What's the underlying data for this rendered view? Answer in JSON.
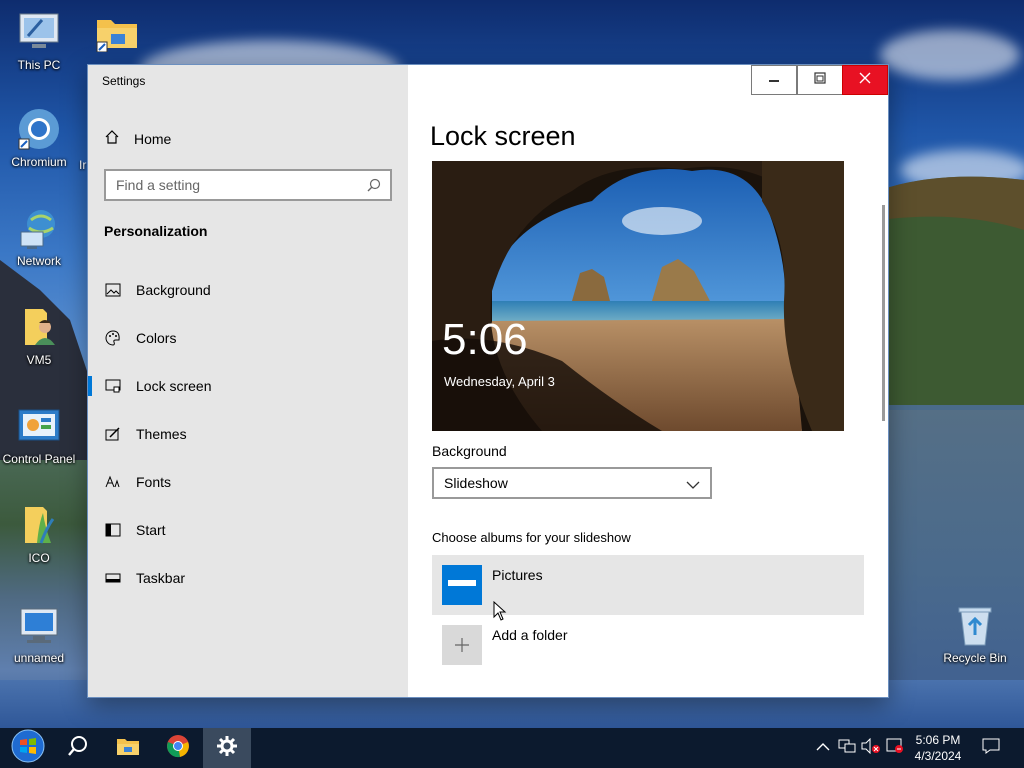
{
  "desktop": {
    "icons": [
      {
        "label": "This PC",
        "icon": "this-pc-icon"
      },
      {
        "label": "",
        "icon": "folder-shortcut-icon"
      },
      {
        "label": "Chromium",
        "icon": "chromium-icon"
      },
      {
        "label": "Network",
        "icon": "network-icon"
      },
      {
        "label": "VM5",
        "icon": "user-folder-icon"
      },
      {
        "label": "Control Panel",
        "icon": "control-panel-icon"
      },
      {
        "label": "ICO",
        "icon": "ico-folder-icon"
      },
      {
        "label": "unnamed",
        "icon": "monitor-icon"
      },
      {
        "label": "Recycle Bin",
        "icon": "recycle-bin-icon"
      }
    ],
    "partial_labels": {
      "chromium_neighbor": "Ir"
    }
  },
  "window": {
    "title": "Settings",
    "controls": {
      "minimize": "minimize-icon",
      "maximize": "maximize-icon",
      "close": "close-icon"
    },
    "sidebar": {
      "home_label": "Home",
      "search_placeholder": "Find a setting",
      "section_title": "Personalization",
      "items": [
        {
          "label": "Background",
          "icon": "picture-icon",
          "active": false
        },
        {
          "label": "Colors",
          "icon": "palette-icon",
          "active": false
        },
        {
          "label": "Lock screen",
          "icon": "lock-screen-icon",
          "active": true
        },
        {
          "label": "Themes",
          "icon": "themes-icon",
          "active": false
        },
        {
          "label": "Fonts",
          "icon": "fonts-icon",
          "active": false
        },
        {
          "label": "Start",
          "icon": "start-icon",
          "active": false
        },
        {
          "label": "Taskbar",
          "icon": "taskbar-icon",
          "active": false
        }
      ]
    },
    "content": {
      "title": "Lock screen",
      "preview": {
        "time": "5:06",
        "date": "Wednesday, April 3"
      },
      "background_label": "Background",
      "background_value": "Slideshow",
      "albums_label": "Choose albums for your slideshow",
      "albums": [
        {
          "name": "Pictures"
        }
      ],
      "add_folder_label": "Add a folder"
    }
  },
  "taskbar": {
    "buttons": [
      "start-icon",
      "search-icon",
      "file-explorer-icon",
      "chrome-icon",
      "settings-icon"
    ],
    "tray": [
      "chevron-up-icon",
      "network-icon",
      "volume-muted-icon",
      "action-center-alert-icon",
      "notification-icon"
    ],
    "clock": {
      "time": "5:06 PM",
      "date": "4/3/2024"
    }
  },
  "colors": {
    "accent": "#0078d7",
    "close": "#e81123",
    "sidebar_bg": "#e6e6e6",
    "taskbar_bg": "#0c1a2e"
  }
}
